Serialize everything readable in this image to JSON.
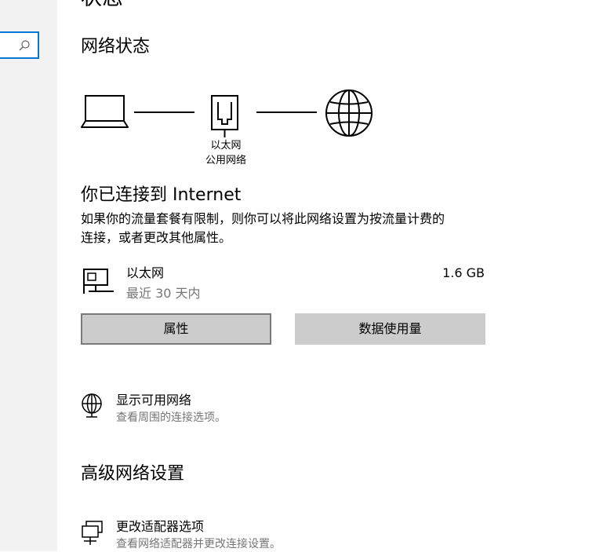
{
  "sidebar": {
    "search": {
      "icon": "search-icon"
    }
  },
  "page": {
    "title": "状态",
    "network_status_heading": "网络状态",
    "diagram": {
      "adapter_name": "以太网",
      "network_type": "公用网络",
      "icons": [
        "laptop-icon",
        "ethernet-port-icon",
        "globe-icon"
      ]
    },
    "connection": {
      "heading": "你已连接到 Internet",
      "description_line1": "如果你的流量套餐有限制，则你可以将此网络设置为按流量计费的",
      "description_line2": "连接，或者更改其他属性。"
    },
    "adapter": {
      "name": "以太网",
      "period": "最近 30 天内",
      "usage": "1.6 GB",
      "icon": "ethernet-adapter-icon"
    },
    "buttons": {
      "properties": "属性",
      "data_usage": "数据使用量"
    },
    "show_networks": {
      "title": "显示可用网络",
      "subtitle": "查看周围的连接选项。",
      "icon": "globe-network-icon"
    },
    "advanced": {
      "heading": "高级网络设置",
      "change_adapter": {
        "title": "更改适配器选项",
        "subtitle": "查看网络适配器并更改连接设置。",
        "icon": "network-adapter-icon"
      }
    }
  }
}
